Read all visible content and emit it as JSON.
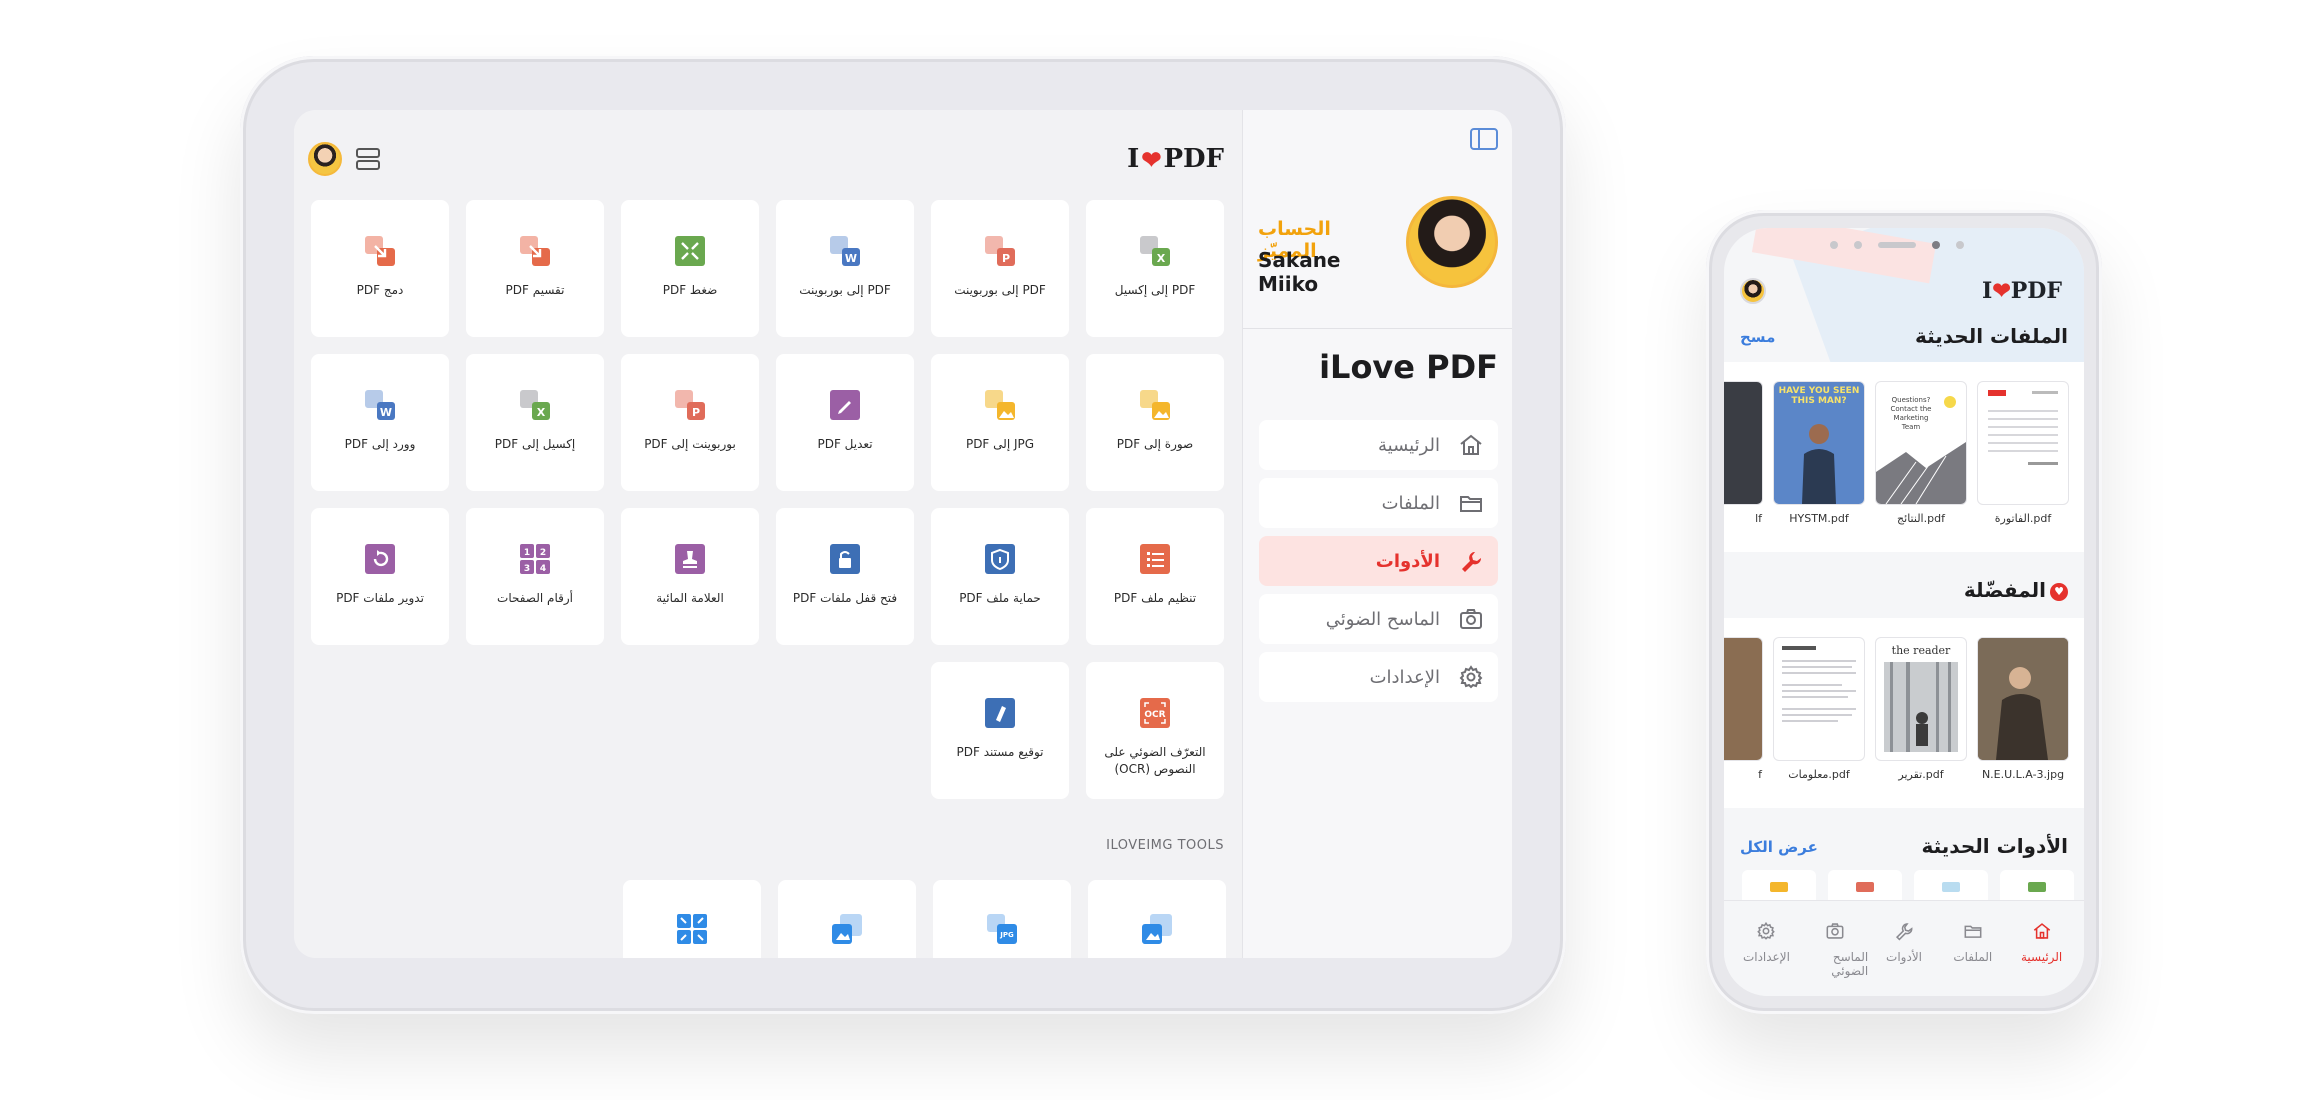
{
  "colors": {
    "brand_red": "#e5322d",
    "accent_orange": "#f2a20c",
    "link_blue": "#3b7ddd"
  },
  "tablet": {
    "logo": {
      "pre": "I",
      "post": "PDF"
    },
    "tools": [
      {
        "label": "PDF إلى إكسيل",
        "icon": "excel-icon",
        "color": "#6aa84f"
      },
      {
        "label": "PDF إلى بوربوينت",
        "icon": "powerpoint-icon",
        "color": "#e06c5a"
      },
      {
        "label": "PDF إلى بوربوينت",
        "icon": "word-icon",
        "color": "#4a78c2"
      },
      {
        "label": "ضغط PDF",
        "icon": "compress-icon",
        "color": "#6aa84f"
      },
      {
        "label": "تقسيم PDF",
        "icon": "split-icon",
        "color": "#e56a4a"
      },
      {
        "label": "دمج PDF",
        "icon": "merge-icon",
        "color": "#e56a4a"
      },
      {
        "label": "صورة إلى PDF",
        "icon": "image-icon",
        "color": "#f4b62c"
      },
      {
        "label": "JPG إلى PDF",
        "icon": "jpg-icon",
        "color": "#f4b62c"
      },
      {
        "label": "تعديل PDF",
        "icon": "edit-icon",
        "color": "#9b5fa5"
      },
      {
        "label": "بوربوينت إلى PDF",
        "icon": "ppt-to-pdf-icon",
        "color": "#e06c5a"
      },
      {
        "label": "إكسيل إلى PDF",
        "icon": "excel-to-pdf-icon",
        "color": "#6aa84f"
      },
      {
        "label": "وورد إلى PDF",
        "icon": "word-to-pdf-icon",
        "color": "#4a78c2"
      },
      {
        "label": "تنظيم ملف PDF",
        "icon": "organize-icon",
        "color": "#e56a4a"
      },
      {
        "label": "حماية ملف PDF",
        "icon": "shield-icon",
        "color": "#3d6fb5"
      },
      {
        "label": "فتح قفل ملفات PDF",
        "icon": "unlock-icon",
        "color": "#3d6fb5"
      },
      {
        "label": "العلامة المائية",
        "icon": "watermark-icon",
        "color": "#9b5fa5"
      },
      {
        "label": "أرقام الصفحات",
        "icon": "page-numbers-icon",
        "color": "#9b5fa5"
      },
      {
        "label": "تدوير ملفات PDF",
        "icon": "rotate-icon",
        "color": "#9b5fa5"
      },
      {
        "label": "التعرّف الضوئي على النصوص (OCR)",
        "icon": "ocr-icon",
        "color": "#e56a4a"
      },
      {
        "label": "توقيع مستند PDF",
        "icon": "sign-icon",
        "color": "#3d6fb5"
      }
    ],
    "img_tools_label": "ILOVEIMG TOOLS",
    "img_tools": [
      {
        "icon": "resize-image-icon",
        "color": "#2f8be6"
      },
      {
        "icon": "convert-jpg-icon",
        "color": "#2f8be6"
      },
      {
        "icon": "upscale-image-icon",
        "color": "#2f8be6"
      },
      {
        "icon": "compress-image-icon",
        "color": "#2f8be6"
      }
    ],
    "profile": {
      "tier": "الحساب المميّز",
      "name": "Sakane Miiko"
    },
    "app_title": "iLove PDF",
    "nav": [
      {
        "label": "الرئيسية",
        "icon": "home-icon",
        "active": false
      },
      {
        "label": "الملفات",
        "icon": "folder-icon",
        "active": false
      },
      {
        "label": "الأدوات",
        "icon": "wrench-icon",
        "active": true
      },
      {
        "label": "الماسح الضوئي",
        "icon": "camera-icon",
        "active": false
      },
      {
        "label": "الإعدادات",
        "icon": "gear-icon",
        "active": false
      }
    ]
  },
  "phone": {
    "logo": {
      "pre": "I",
      "post": "PDF"
    },
    "recent_files": {
      "title": "الملفات الحديثة",
      "action": "مسح",
      "files": [
        "الفاتورة.pdf",
        "النتائج.pdf",
        "HYSTM.pdf",
        "lf"
      ],
      "poster_text": "HAVE YOU SEEN THIS MAN?",
      "doc_text": "Questions? Contact the Marketing Team"
    },
    "favorites": {
      "title": "المفضّلة",
      "files": [
        "N.E.U.L.A-3.jpg",
        "تقرير.pdf",
        "معلومات.pdf",
        "f"
      ],
      "reader_text": "the reader"
    },
    "recent_tools": {
      "title": "الأدوات الحديثة",
      "action": "عرض الكل"
    },
    "tabs": [
      {
        "label": "الرئيسية",
        "icon": "home-icon",
        "active": true
      },
      {
        "label": "الملفات",
        "icon": "folder-icon",
        "active": false
      },
      {
        "label": "الأدوات",
        "icon": "wrench-icon",
        "active": false
      },
      {
        "label": "الماسح الضوئي",
        "icon": "camera-icon",
        "active": false
      },
      {
        "label": "الإعدادات",
        "icon": "gear-icon",
        "active": false
      }
    ]
  }
}
